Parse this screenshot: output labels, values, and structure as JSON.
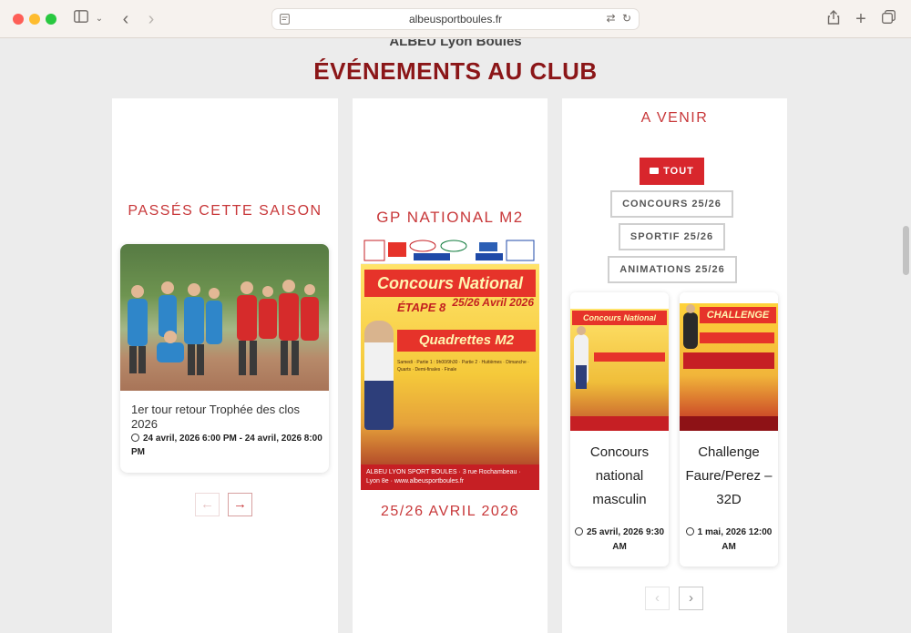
{
  "browser": {
    "url": "albeusportboules.fr"
  },
  "page": {
    "brand": "ALBEU Lyon Boules",
    "section_title": "ÉVÉNEMENTS AU CLUB"
  },
  "past": {
    "heading": "PASSÉS CETTE SAISON",
    "event_title": "1er tour retour Trophée des clos 2026",
    "event_date": "24 avril, 2026 6:00 PM - 24 avril, 2026 8:00 PM",
    "prev_label": "←",
    "next_label": "→"
  },
  "featured": {
    "heading": "GP NATIONAL M2",
    "poster": {
      "logos": "VILLE DE LYON · André et Fils · La Région · INTERSPORT",
      "band": "Concours National",
      "etape": "ÉTAPE 8",
      "date": "25/26 Avril 2026",
      "sub": "Quadrettes M2",
      "lines": "Samedi · Partie 1 : 9h00/9h30 · Partie 2 · Huitièmes · Dimanche · Quarts · Demi-finales · Finale",
      "footer": "ALBEU LYON SPORT BOULES · 3 rue Rochambeau · Lyon 8e · www.albeusportboules.fr"
    },
    "caption": "25/26 AVRIL 2026"
  },
  "upcoming": {
    "heading": "A VENIR",
    "filters": {
      "all": "TOUT",
      "concours": "CONCOURS 25/26",
      "sportif": "SPORTIF 25/26",
      "animations": "ANIMATIONS 25/26"
    },
    "events": [
      {
        "title": "Concours national masculin",
        "date": "25 avril, 2026 9:30 AM",
        "thumb_band": "Concours National"
      },
      {
        "title": "Challenge Faure/Perez – 32D",
        "date": "1 mai, 2026 12:00 AM",
        "thumb_band": "CHALLENGE"
      }
    ],
    "prev_label": "‹",
    "next_label": "›"
  },
  "colors": {
    "brand_dark_red": "#8b1618",
    "accent_red": "#c8383a",
    "active_filter": "#d8262c"
  }
}
